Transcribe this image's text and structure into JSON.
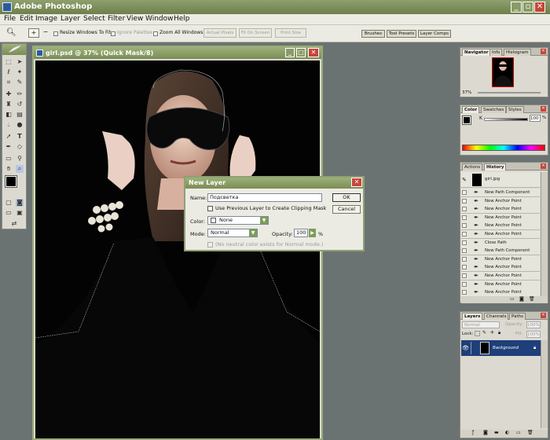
{
  "app": {
    "title": "Adobe Photoshop",
    "accent": "#7a8d56"
  },
  "menu": [
    "File",
    "Edit",
    "Image",
    "Layer",
    "Select",
    "Filter",
    "View",
    "Window",
    "Help"
  ],
  "options": {
    "resize_windows": "Resize Windows To Fit",
    "ignore_palettes": "Ignore Palettes",
    "zoom_all": "Zoom All Windows",
    "actual_pixels": "Actual Pixels",
    "fit_on_screen": "Fit On Screen",
    "print_size": "Print Size",
    "palette_tabs": [
      "Brushes",
      "Tool Presets",
      "Layer Comps"
    ]
  },
  "document": {
    "title": "girl.psd @ 37% (Quick Mask/8)"
  },
  "dialog": {
    "title": "New Layer",
    "name_label": "Name:",
    "name_value": "Подсветка",
    "clipping_label": "Use Previous Layer to Create Clipping Mask",
    "color_label": "Color:",
    "color_value": "None",
    "mode_label": "Mode:",
    "mode_value": "Normal",
    "opacity_label": "Opacity:",
    "opacity_value": "100",
    "opacity_unit": "%",
    "neutral_label": "(No neutral color exists for Normal mode.)",
    "ok": "OK",
    "cancel": "Cancel"
  },
  "navigator": {
    "tabs": [
      "Navigator",
      "Info",
      "Histogram"
    ],
    "zoom": "37%"
  },
  "color_panel": {
    "tabs": [
      "Color",
      "Swatches",
      "Styles"
    ],
    "channel": "K",
    "value": "100",
    "unit": "%"
  },
  "history": {
    "tabs": [
      "Actions",
      "History"
    ],
    "snapshot": "girl.jpg",
    "items": [
      {
        "label": "New Path Component",
        "icon": "pen-icon"
      },
      {
        "label": "New Anchor Point",
        "icon": "pen-icon"
      },
      {
        "label": "New Anchor Point",
        "icon": "pen-icon"
      },
      {
        "label": "New Anchor Point",
        "icon": "pen-icon"
      },
      {
        "label": "New Anchor Point",
        "icon": "pen-icon"
      },
      {
        "label": "New Anchor Point",
        "icon": "pen-icon"
      },
      {
        "label": "Close Path",
        "icon": "pen-icon"
      },
      {
        "label": "New Path Component",
        "icon": "pen-icon"
      },
      {
        "label": "New Anchor Point",
        "icon": "pen-icon"
      },
      {
        "label": "New Anchor Point",
        "icon": "pen-icon"
      },
      {
        "label": "New Anchor Point",
        "icon": "pen-icon"
      },
      {
        "label": "New Anchor Point",
        "icon": "pen-icon"
      },
      {
        "label": "New Anchor Point",
        "icon": "pen-icon"
      }
    ]
  },
  "layers": {
    "tabs": [
      "Layers",
      "Channels",
      "Paths"
    ],
    "blend_mode": "Normal",
    "opacity_label": "Opacity:",
    "opacity_value": "100%",
    "lock_label": "Lock:",
    "fill_label": "Fill:",
    "fill_value": "100%",
    "layer_name": "Background"
  }
}
